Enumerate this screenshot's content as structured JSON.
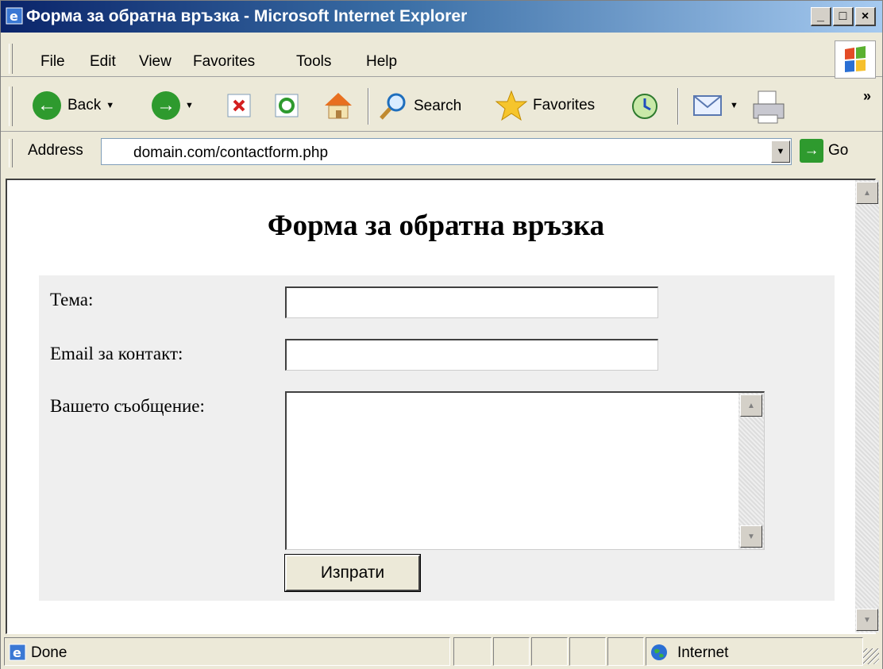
{
  "window": {
    "title": "Форма за обратна връзка - Microsoft Internet Explorer",
    "minimize": "_",
    "maximize": "□",
    "close": "×"
  },
  "menu": [
    "File",
    "Edit",
    "View",
    "Favorites",
    "Tools",
    "Help"
  ],
  "toolbar": {
    "back": "Back",
    "search": "Search",
    "favorites": "Favorites",
    "chevron": "»"
  },
  "address": {
    "label": "Address",
    "url": "domain.com/contactform.php",
    "go": "Go"
  },
  "page": {
    "heading": "Форма за обратна връзка",
    "fields": {
      "subject_label": "Тема:",
      "email_label": "Email за контакт:",
      "message_label": "Вашето съобщение:"
    },
    "submit": "Изпрати"
  },
  "status": {
    "text": "Done",
    "zone": "Internet"
  }
}
